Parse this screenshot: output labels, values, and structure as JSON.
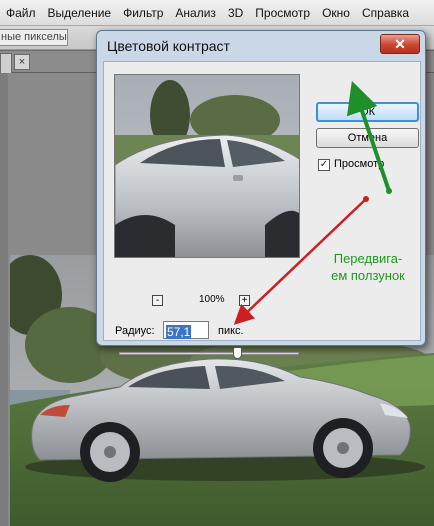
{
  "menubar": {
    "items": [
      "Файл",
      "Выделение",
      "Фильтр",
      "Анализ",
      "3D",
      "Просмотр",
      "Окно",
      "Справка"
    ]
  },
  "options_bar": {
    "field_text": "ные пикселы"
  },
  "tab": {
    "close_glyph": "×"
  },
  "dialog": {
    "title": "Цветовой контраст",
    "close_glyph": "✕",
    "ok_label": "ОК",
    "cancel_label": "Отмена",
    "preview_label": "Просмотр",
    "preview_checked": true,
    "check_glyph": "✓",
    "zoom_out_glyph": "-",
    "zoom_in_glyph": "+",
    "zoom_level": "100%",
    "radius_label": "Радиус:",
    "radius_value": "57,1",
    "units_label": "пикс.",
    "slider_fraction": 0.66
  },
  "annotation": {
    "text": "Передвига-\nем ползунок",
    "color": "#1c9a1c",
    "arrow_colors": {
      "green": "#1f8f2a",
      "red": "#cc1f1f"
    }
  },
  "colors": {
    "ok_focus": "#3a8ee0",
    "close_button": "#c9452f",
    "selection": "#3b74c8"
  }
}
